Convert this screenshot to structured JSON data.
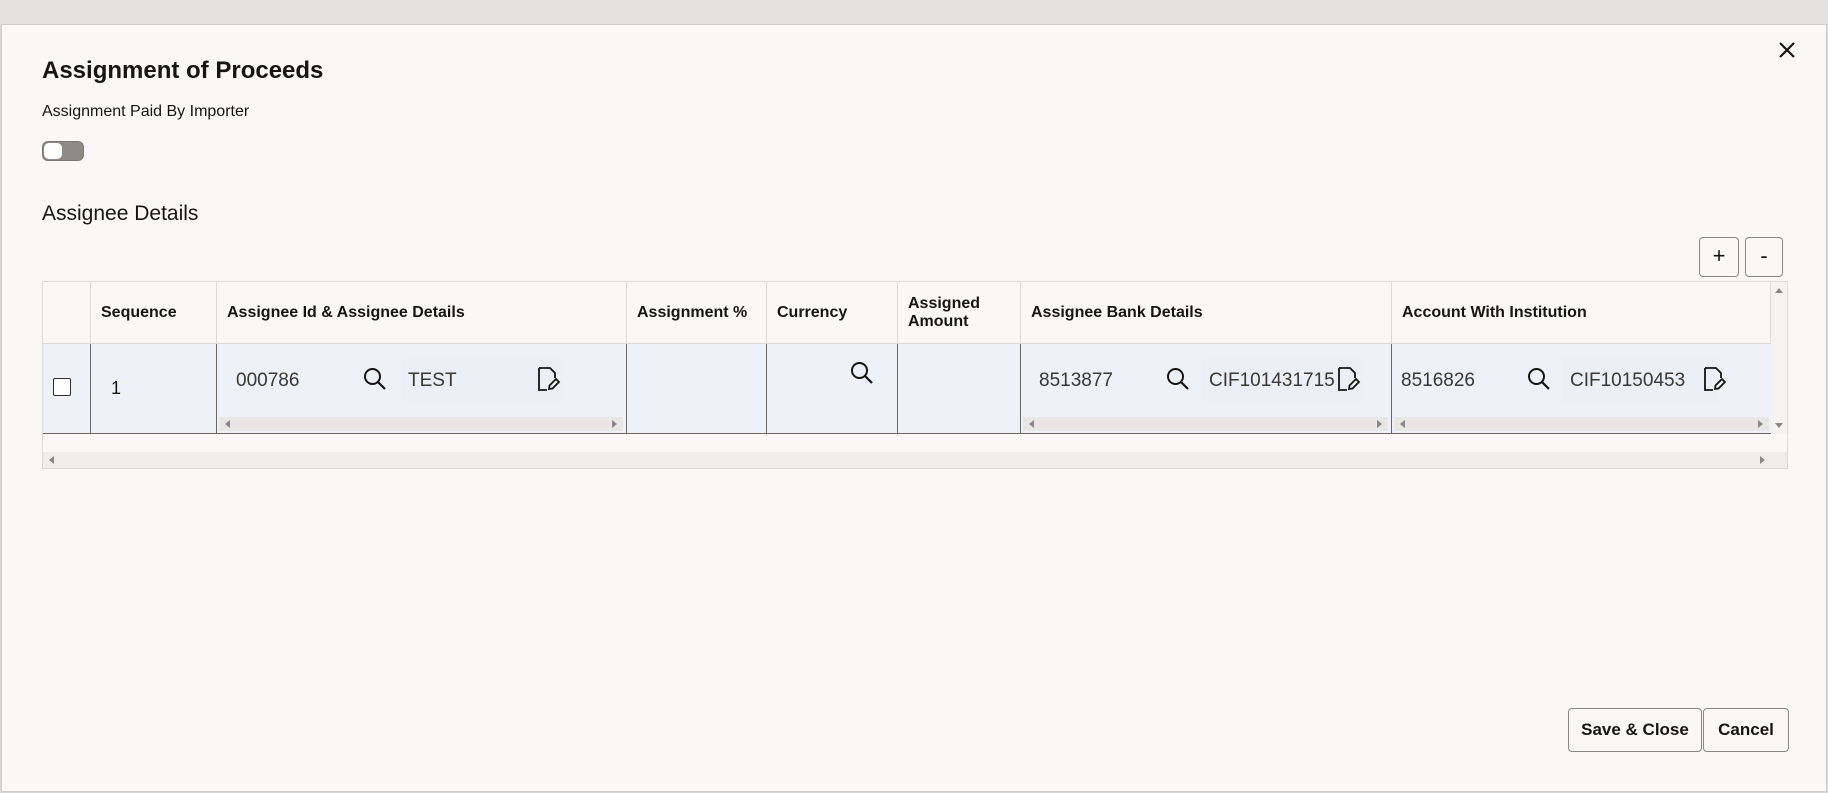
{
  "dialog": {
    "title": "Assignment of Proceeds",
    "toggle_label": "Assignment Paid By Importer",
    "toggle_on": false,
    "section_title": "Assignee Details",
    "add_label": "+",
    "remove_label": "-"
  },
  "table": {
    "headers": [
      "Sequence",
      "Assignee Id & Assignee Details",
      "Assignment %",
      "Currency",
      "Assigned Amount",
      "Assignee Bank Details",
      "Account With Institution"
    ],
    "rows": [
      {
        "selected": false,
        "sequence": "1",
        "assignee_id": "000786",
        "assignee_name": "TEST",
        "assignment_pct": "",
        "currency": "",
        "assigned_amount": "",
        "bank_id": "8513877",
        "bank_cif": "CIF101431715",
        "awi_id": "8516826",
        "awi_cif": "CIF10150453"
      }
    ]
  },
  "footer": {
    "save_label": "Save & Close",
    "cancel_label": "Cancel"
  },
  "icons": {
    "search": "search-icon",
    "edit": "edit-document-icon",
    "close": "close-icon"
  }
}
